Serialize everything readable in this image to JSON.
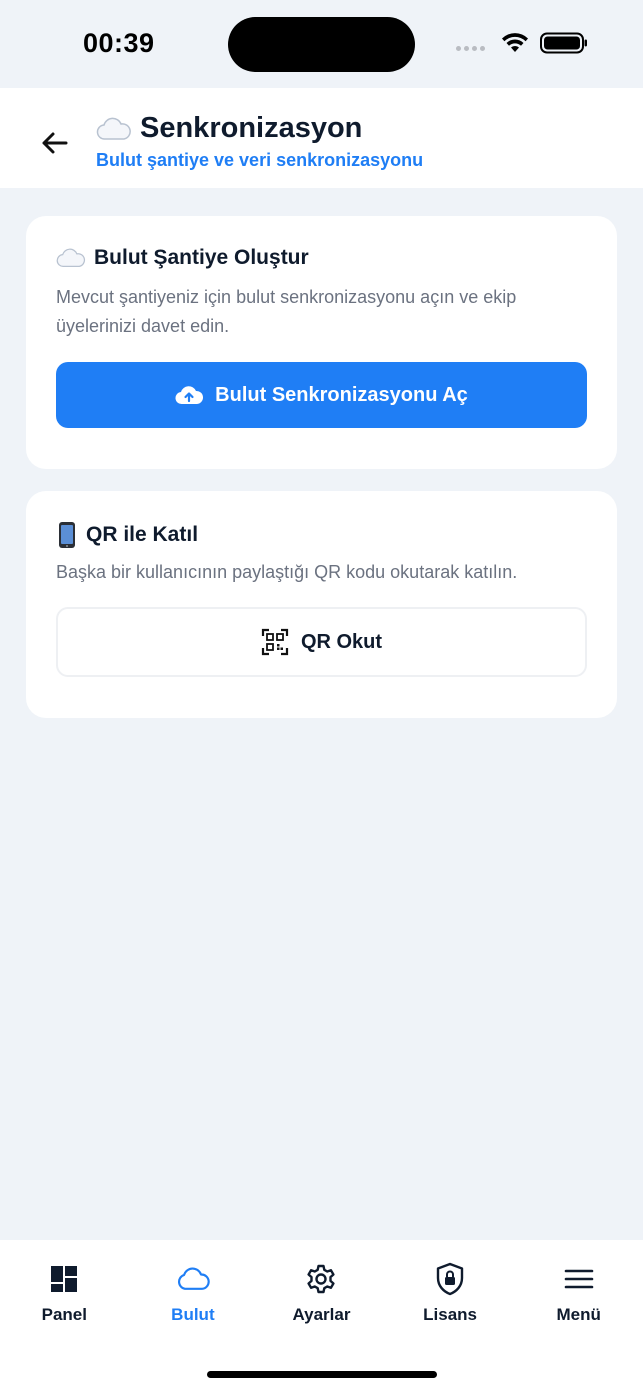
{
  "status_bar": {
    "time": "00:39"
  },
  "header": {
    "title": "Senkronizasyon",
    "title_icon": "cloud-emoji",
    "subtitle": "Bulut şantiye ve veri senkronizasyonu"
  },
  "cloud_card": {
    "title": "Bulut Şantiye Oluştur",
    "title_icon": "cloud-emoji",
    "description": "Mevcut şantiyeniz için bulut senkronizasyonu açın ve ekip üyelerinizi davet edin.",
    "button_label": "Bulut Senkronizasyonu Aç",
    "button_icon": "cloud-upload-icon"
  },
  "qr_card": {
    "title": "QR ile Katıl",
    "title_icon": "mobile-phone-emoji",
    "description": "Başka bir kullanıcının paylaştığı QR kodu okutarak katılın.",
    "button_label": "QR Okut",
    "button_icon": "qr-scan-icon"
  },
  "tabbar": {
    "tabs": [
      {
        "label": "Panel",
        "icon": "dashboard-icon"
      },
      {
        "label": "Bulut",
        "icon": "cloud-icon",
        "active": true
      },
      {
        "label": "Ayarlar",
        "icon": "gear-icon"
      },
      {
        "label": "Lisans",
        "icon": "shield-lock-icon"
      },
      {
        "label": "Menü",
        "icon": "menu-icon"
      }
    ]
  },
  "colors": {
    "accent": "#1f7ef5",
    "background": "#eff3f8",
    "text_primary": "#0f1b2d",
    "text_secondary": "#6b7280"
  }
}
